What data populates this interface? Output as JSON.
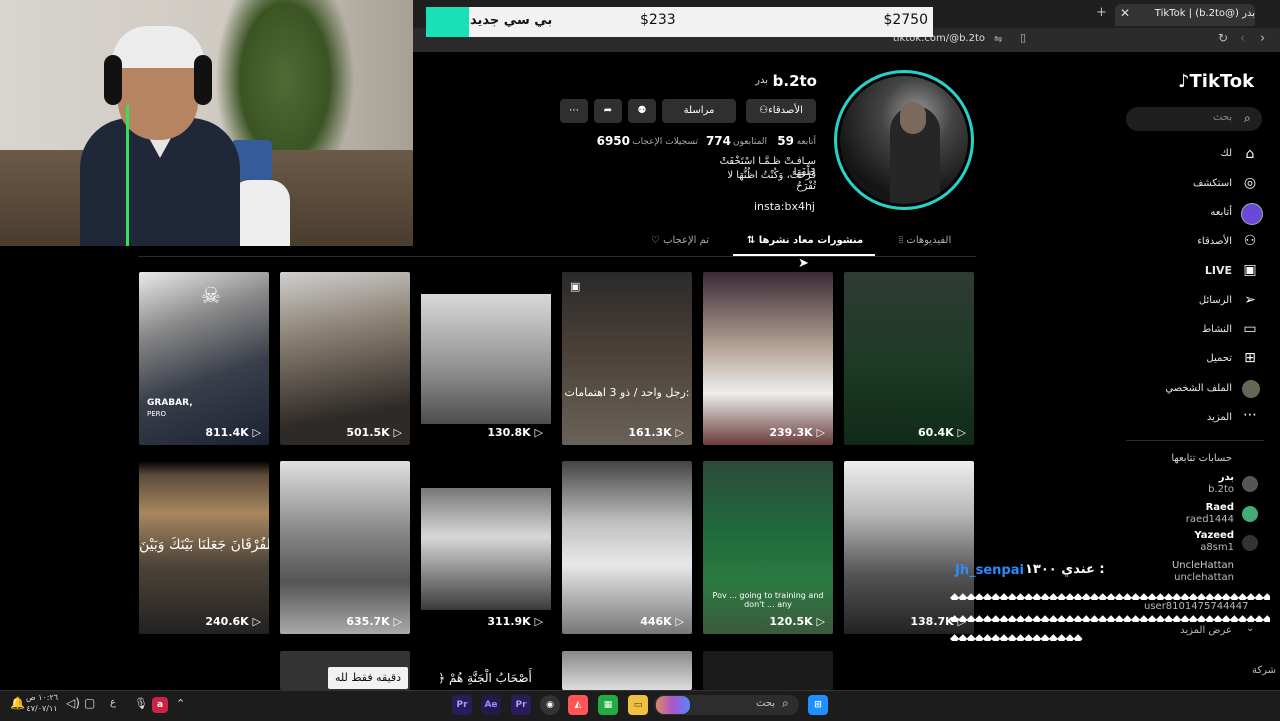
{
  "browser": {
    "tab_title": "TikTok | (b.2to@) بدر",
    "url": "tiktok.com/@b.2to"
  },
  "donation": {
    "label": "بي سي جديد",
    "current": "$233",
    "goal": "$2750",
    "progress_fraction": 0.085
  },
  "sidebar": {
    "logo": "TikTok",
    "search_placeholder": "بحث",
    "items": [
      {
        "label": "لك",
        "icon": "home-icon"
      },
      {
        "label": "استكشف",
        "icon": "compass-icon"
      },
      {
        "label": "أتابعه",
        "icon": "following-avatar-icon"
      },
      {
        "label": "الأصدقاء",
        "icon": "friends-icon"
      },
      {
        "label": "LIVE",
        "icon": "live-icon"
      },
      {
        "label": "الرسائل",
        "icon": "send-icon"
      },
      {
        "label": "النشاط",
        "icon": "activity-icon"
      },
      {
        "label": "تحميل",
        "icon": "upload-icon"
      },
      {
        "label": "الملف الشخصي",
        "icon": "profile-avatar-icon"
      },
      {
        "label": "المزيد",
        "icon": "more-icon"
      }
    ],
    "following_title": "حسابات تتابعها",
    "following": [
      {
        "name": "بدر",
        "handle": "b.2to"
      },
      {
        "name": "Raed",
        "handle": "raed1444"
      },
      {
        "name": "Yazeed",
        "handle": "a8sm1"
      },
      {
        "name": "UncleHattan",
        "handle": "unclehattan"
      }
    ],
    "show_more": "عرض المزيد",
    "company": "شركة"
  },
  "profile": {
    "username": "b.2to",
    "nickname": "بدر",
    "buttons": {
      "friends": "الأصدقاء",
      "message": "مراسلة"
    },
    "stats": {
      "following_label": "أتابعه",
      "following": "59",
      "followers_label": "المتابعون",
      "followers": "774",
      "likes_label": "تسجيلات الإعجاب",
      "likes": "6950"
    },
    "bio_line1": "سـافـتْ ظـمَّـا اسْتَخْفَتْ خَلْفَهَا",
    "bio_line2": "فُرْحَتْ، وَكُنْتُ اظُنُّهَا لا تُفْرَحُ",
    "insta": "insta:bx4hj"
  },
  "tabs": {
    "videos": "الفيديوهات",
    "reposts": "منشورات معاد نشرها",
    "liked": "تم الإعجاب"
  },
  "videos_row1": [
    "811.4K",
    "501.5K",
    "130.8K",
    "161.3K",
    "239.3K",
    "60.4K"
  ],
  "videos_row2": [
    "240.6K",
    "635.7K",
    "311.9K",
    "446K",
    "120.5K",
    "138.7K"
  ],
  "captions": {
    "v1_a": "GRABAR,",
    "v1_b": "PERO",
    "v4": "رجل واحد / ذو 3 اهتمامات:",
    "v7": "تُ الفُرْقَانَ جَعَلْنَا بَيْنَكَ وَبَيْنَ",
    "v11": "Pov ... going to training and don't ... any"
  },
  "chat": {
    "name": "Jh_senpai",
    "message": "عندي ١٣٠٠ :",
    "user2": "user8101475744447"
  },
  "subtitles": {
    "left": "دقيقه فقط لله",
    "middle": "﴿ أَصْحَابُ الْجَنَّةِ هُمْ"
  },
  "taskbar": {
    "search": "بحث",
    "time": "١٠:٢٦ ص",
    "date": "٤٧/٠٧/١١"
  }
}
